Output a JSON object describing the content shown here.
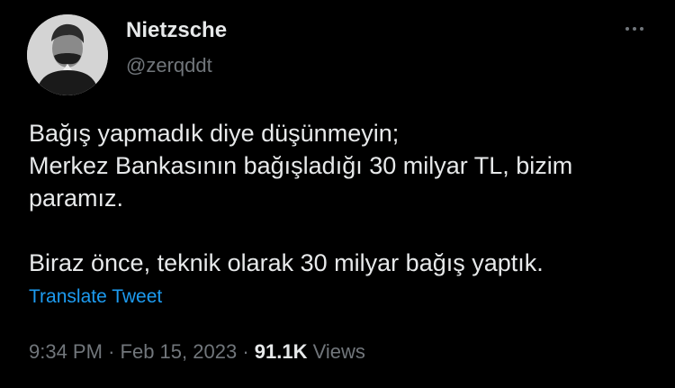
{
  "author": {
    "name": "Nietzsche",
    "handle": "@zerqddt",
    "avatar_icon": "portrait-avatar-icon"
  },
  "tweet": {
    "paragraph_1_line_1": "Bağış yapmadık diye düşünmeyin;",
    "paragraph_1_line_2": "Merkez Bankasının bağışladığı 30 milyar TL, bizim paramız.",
    "paragraph_2": "Biraz önce, teknik olarak 30 milyar bağış yaptık."
  },
  "translate_label": "Translate Tweet",
  "meta": {
    "time": "9:34 PM",
    "separator": "·",
    "date": "Feb 15, 2023",
    "views_count": "91.1K",
    "views_label": "Views"
  },
  "more_icon": "more-dots-icon",
  "colors": {
    "background": "#000000",
    "primary_text": "#e7e9ea",
    "secondary_text": "#71767b",
    "link": "#1d9bf0"
  }
}
